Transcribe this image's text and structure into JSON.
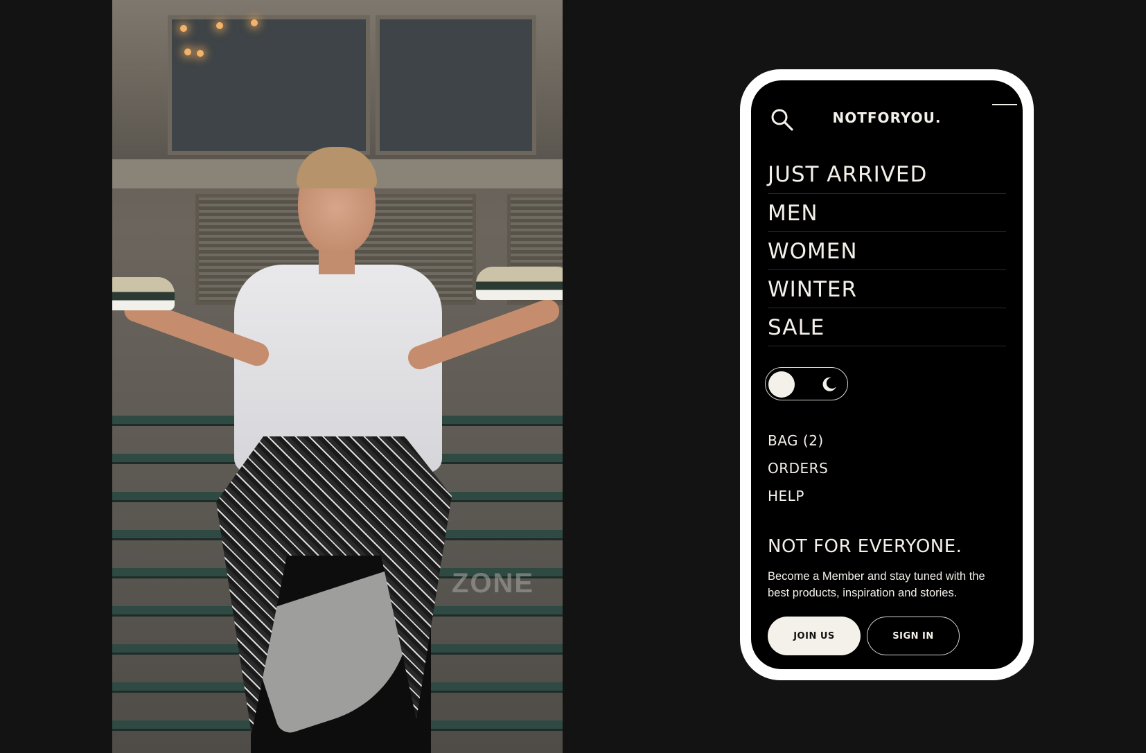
{
  "photo": {
    "alt": "",
    "sign_text": "ZONE"
  },
  "header": {
    "brand": "NOTFORYOU.",
    "search_icon": "search-icon",
    "menu_icon": "menu-icon"
  },
  "nav": {
    "items": [
      {
        "label": "JUST ARRIVED"
      },
      {
        "label": "MEN"
      },
      {
        "label": "WOMEN"
      },
      {
        "label": "WINTER"
      },
      {
        "label": "SALE"
      }
    ]
  },
  "theme_toggle": {
    "icon": "moon-icon",
    "state": "light"
  },
  "account_links": [
    {
      "label": "BAG (2)"
    },
    {
      "label": "ORDERS"
    },
    {
      "label": "HELP"
    }
  ],
  "promo": {
    "tagline": "NOT FOR EVERYONE.",
    "text": "Become a Member and stay tuned with the best products, inspiration and stories.",
    "join_label": "JOIN US",
    "signin_label": "SIGN IN"
  },
  "colors": {
    "background": "#131313",
    "phone_frame": "#ffffff",
    "screen": "#000000",
    "text": "#f4f1ea"
  }
}
